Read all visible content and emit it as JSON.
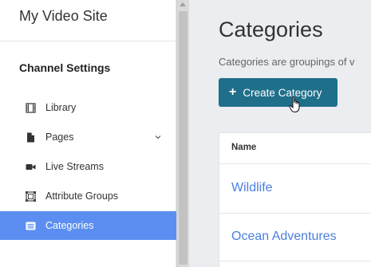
{
  "site": {
    "title": "My Video Site"
  },
  "sidebar": {
    "section_title": "Channel Settings",
    "items": [
      {
        "label": "Library",
        "icon": "film-icon"
      },
      {
        "label": "Pages",
        "icon": "page-icon",
        "has_submenu": true
      },
      {
        "label": "Live Streams",
        "icon": "video-camera-icon"
      },
      {
        "label": "Attribute Groups",
        "icon": "attribute-groups-icon"
      },
      {
        "label": "Categories",
        "icon": "list-icon",
        "active": true
      }
    ]
  },
  "main": {
    "title": "Categories",
    "description": "Categories are groupings of v",
    "create_button": {
      "label": "Create Category",
      "icon": "plus-icon"
    },
    "table": {
      "header": "Name",
      "rows": [
        "Wildlife",
        "Ocean Adventures"
      ]
    }
  },
  "colors": {
    "accent": "#5b8ef0",
    "button": "#1f6f8b",
    "link": "#4a7fe0"
  }
}
